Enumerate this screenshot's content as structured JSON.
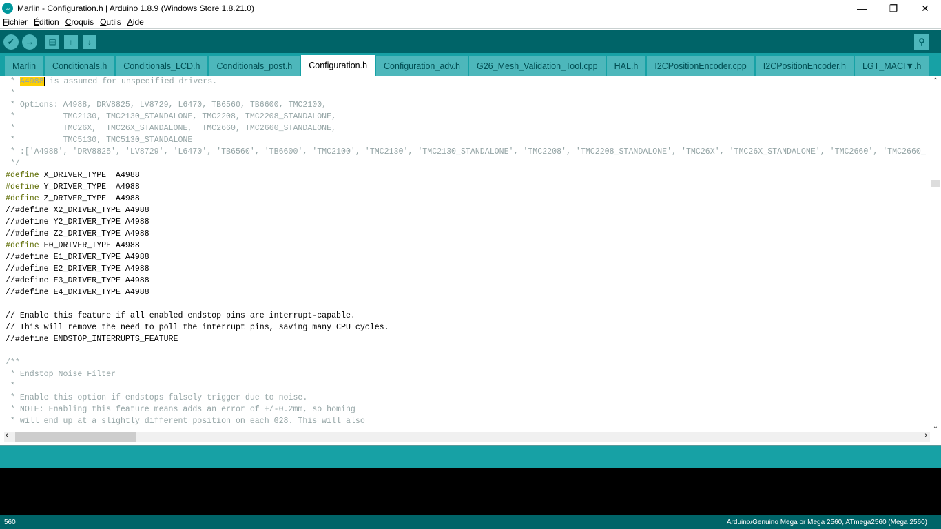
{
  "window": {
    "title": "Marlin - Configuration.h | Arduino 1.8.9 (Windows Store 1.8.21.0)",
    "minimize": "—",
    "maximize": "❐",
    "close": "✕"
  },
  "menu": [
    "Fichier",
    "Édition",
    "Croquis",
    "Outils",
    "Aide"
  ],
  "toolbar": {
    "verify": "✓",
    "upload": "→",
    "new": "▤",
    "open": "↑",
    "save": "↓",
    "serial_monitor": "⚲"
  },
  "tabs": [
    "Marlin",
    "Conditionals.h",
    "Conditionals_LCD.h",
    "Conditionals_post.h",
    "Configuration.h",
    "Configuration_adv.h",
    "G26_Mesh_Validation_Tool.cpp",
    "HAL.h",
    "I2CPositionEncoder.cpp",
    "I2CPositionEncoder.h",
    "LGT_MACI▼.h"
  ],
  "active_tab": "Configuration.h",
  "editor": {
    "highlight": "A4988",
    "first_line_rest": " is assumed for unspecified drivers.",
    "lines": [
      {
        "t": "c",
        "s": " *"
      },
      {
        "t": "c",
        "s": " * Options: A4988, DRV8825, LV8729, L6470, TB6560, TB6600, TMC2100,"
      },
      {
        "t": "c",
        "s": " *          TMC2130, TMC2130_STANDALONE, TMC2208, TMC2208_STANDALONE,"
      },
      {
        "t": "c",
        "s": " *          TMC26X,  TMC26X_STANDALONE,  TMC2660, TMC2660_STANDALONE,"
      },
      {
        "t": "c",
        "s": " *          TMC5130, TMC5130_STANDALONE"
      },
      {
        "t": "c",
        "s": " * :['A4988', 'DRV8825', 'LV8729', 'L6470', 'TB6560', 'TB6600', 'TMC2100', 'TMC2130', 'TMC2130_STANDALONE', 'TMC2208', 'TMC2208_STANDALONE', 'TMC26X', 'TMC26X_STANDALONE', 'TMC2660', 'TMC2660_"
      },
      {
        "t": "c",
        "s": " */"
      },
      {
        "t": "d",
        "s": " X_DRIVER_TYPE  A4988"
      },
      {
        "t": "d",
        "s": " Y_DRIVER_TYPE  A4988"
      },
      {
        "t": "d",
        "s": " Z_DRIVER_TYPE  A4988"
      },
      {
        "t": "p",
        "s": "//#define X2_DRIVER_TYPE A4988"
      },
      {
        "t": "p",
        "s": "//#define Y2_DRIVER_TYPE A4988"
      },
      {
        "t": "p",
        "s": "//#define Z2_DRIVER_TYPE A4988"
      },
      {
        "t": "d",
        "s": " E0_DRIVER_TYPE A4988"
      },
      {
        "t": "p",
        "s": "//#define E1_DRIVER_TYPE A4988"
      },
      {
        "t": "p",
        "s": "//#define E2_DRIVER_TYPE A4988"
      },
      {
        "t": "p",
        "s": "//#define E3_DRIVER_TYPE A4988"
      },
      {
        "t": "p",
        "s": "//#define E4_DRIVER_TYPE A4988"
      },
      {
        "t": "p",
        "s": ""
      },
      {
        "t": "p",
        "s": "// Enable this feature if all enabled endstop pins are interrupt-capable."
      },
      {
        "t": "p",
        "s": "// This will remove the need to poll the interrupt pins, saving many CPU cycles."
      },
      {
        "t": "p",
        "s": "//#define ENDSTOP_INTERRUPTS_FEATURE"
      },
      {
        "t": "p",
        "s": ""
      },
      {
        "t": "c",
        "s": "/**"
      },
      {
        "t": "c",
        "s": " * Endstop Noise Filter"
      },
      {
        "t": "c",
        "s": " *"
      },
      {
        "t": "c",
        "s": " * Enable this option if endstops falsely trigger due to noise."
      },
      {
        "t": "c",
        "s": " * NOTE: Enabling this feature means adds an error of +/-0.2mm, so homing"
      },
      {
        "t": "c",
        "s": " * will end up at a slightly different position on each G28. This will also"
      }
    ],
    "keyword": "#define"
  },
  "status": {
    "line": "560",
    "board": "Arduino/Genuino Mega or Mega 2560, ATmega2560 (Mega 2560)"
  },
  "colors": {
    "teal_dark": "#006468",
    "teal": "#17a1a5",
    "tab": "#4db7bb",
    "keyword": "#5e6d03",
    "comment": "#95a5a6"
  }
}
